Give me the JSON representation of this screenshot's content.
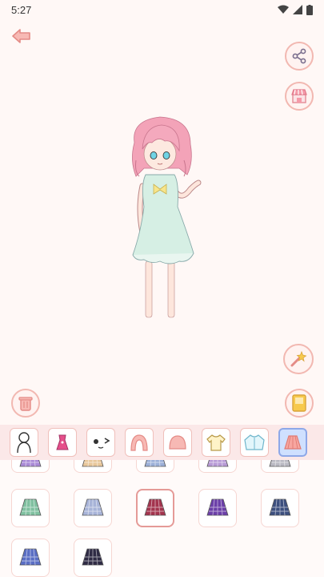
{
  "status_bar": {
    "time": "5:27"
  },
  "icons": {
    "back": "back-arrow-icon",
    "share": "share-icon",
    "shop": "shop-icon",
    "magic": "magic-wand-icon",
    "trash": "trash-icon",
    "save": "save-card-icon"
  },
  "tabs": [
    {
      "name": "body",
      "active": false
    },
    {
      "name": "outfit-sets",
      "active": false
    },
    {
      "name": "face",
      "active": false
    },
    {
      "name": "hair-back",
      "active": false
    },
    {
      "name": "hair-front",
      "active": false
    },
    {
      "name": "tops",
      "active": false
    },
    {
      "name": "jackets",
      "active": false
    },
    {
      "name": "skirts",
      "active": true
    }
  ],
  "skirt_items": [
    {
      "color": "#a98ad6",
      "selected": false,
      "partial": true
    },
    {
      "color": "#e8c79a",
      "selected": false,
      "partial": true
    },
    {
      "color": "#9bb0d8",
      "selected": false,
      "partial": true
    },
    {
      "color": "#b79ad6",
      "selected": false,
      "partial": true
    },
    {
      "color": "#b9b9c2",
      "selected": false,
      "partial": true
    },
    {
      "color": "#7fc0a0",
      "selected": false,
      "partial": false
    },
    {
      "color": "#a7b3d8",
      "selected": false,
      "partial": false
    },
    {
      "color": "#a3344e",
      "selected": true,
      "partial": false
    },
    {
      "color": "#6b3fa8",
      "selected": false,
      "partial": false
    },
    {
      "color": "#3c4f7e",
      "selected": false,
      "partial": false
    },
    {
      "color": "#5a6ec4",
      "selected": false,
      "partial": false
    },
    {
      "color": "#2e2a44",
      "selected": false,
      "partial": false
    }
  ]
}
